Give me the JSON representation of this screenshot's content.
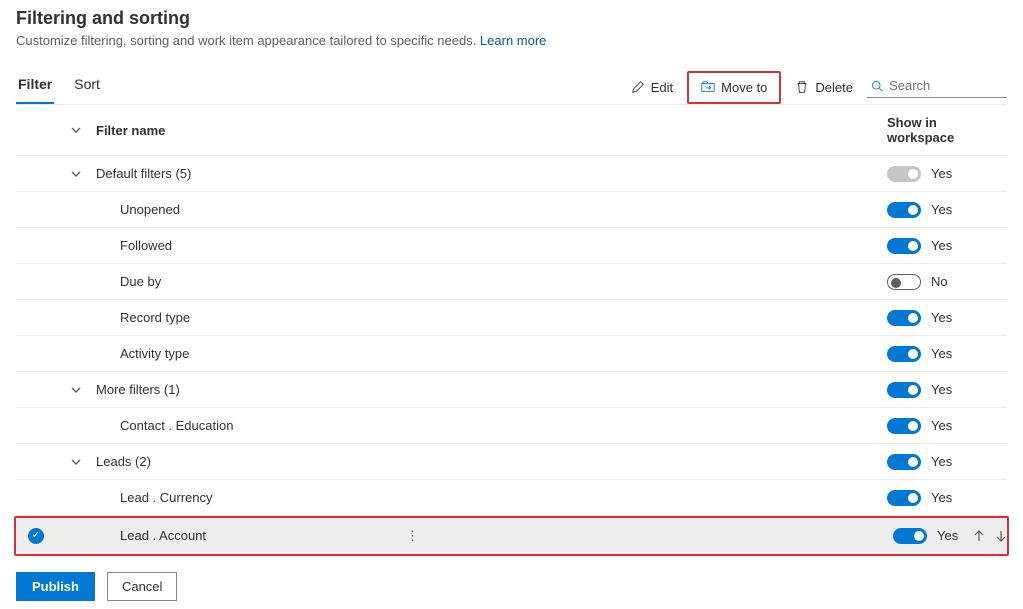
{
  "header": {
    "title": "Filtering and sorting",
    "description": "Customize filtering, sorting and work item appearance tailored to specific needs.",
    "learn_more": "Learn more"
  },
  "tabs": {
    "filter": "Filter",
    "sort": "Sort"
  },
  "toolbar": {
    "edit": "Edit",
    "move_to": "Move to",
    "delete": "Delete",
    "search_placeholder": "Search"
  },
  "columns": {
    "filter_name": "Filter name",
    "show_in_workspace": "Show in workspace"
  },
  "rows": [
    {
      "name": "Default filters (5)",
      "group": true,
      "toggle": "disabled",
      "label": "Yes"
    },
    {
      "name": "Unopened",
      "toggle": "on",
      "label": "Yes"
    },
    {
      "name": "Followed",
      "toggle": "on",
      "label": "Yes"
    },
    {
      "name": "Due by",
      "toggle": "off",
      "label": "No"
    },
    {
      "name": "Record type",
      "toggle": "on",
      "label": "Yes"
    },
    {
      "name": "Activity type",
      "toggle": "on",
      "label": "Yes"
    },
    {
      "name": "More filters (1)",
      "group": true,
      "toggle": "on",
      "label": "Yes"
    },
    {
      "name": "Contact . Education",
      "toggle": "on",
      "label": "Yes"
    },
    {
      "name": "Leads (2)",
      "group": true,
      "toggle": "on",
      "label": "Yes"
    },
    {
      "name": "Lead . Currency",
      "toggle": "on",
      "label": "Yes"
    },
    {
      "name": "Lead . Account",
      "toggle": "on",
      "label": "Yes",
      "selected": true
    }
  ],
  "footer": {
    "publish": "Publish",
    "cancel": "Cancel"
  }
}
